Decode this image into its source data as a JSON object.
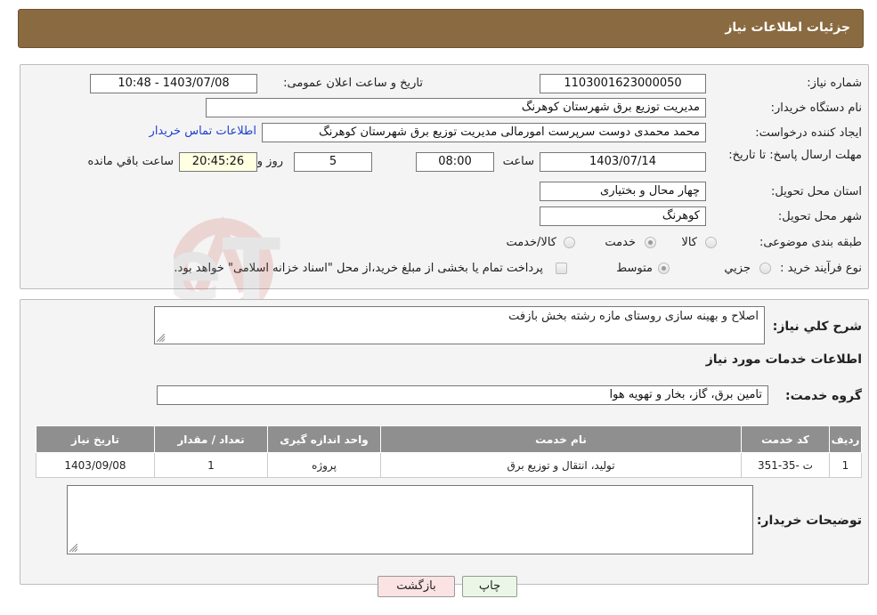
{
  "header": {
    "title": "جزئیات اطلاعات نیاز"
  },
  "form": {
    "need_number": {
      "label": "شماره نیاز:",
      "value": "1103001623000050"
    },
    "announce_datetime": {
      "label": "تاریخ و ساعت اعلان عمومی:",
      "value": "1403/07/08 - 10:48"
    },
    "buyer_org": {
      "label": "نام دستگاه خریدار:",
      "value": "مدیریت توزیع برق شهرستان کوهرنگ"
    },
    "requester": {
      "label": "ایجاد کننده درخواست:",
      "value": "محمد محمدی دوست سرپرست امورمالی مدیریت توزیع برق شهرستان کوهرنگ",
      "contact_link": "اطلاعات تماس خریدار"
    },
    "deadline": {
      "label": "مهلت ارسال پاسخ: تا تاریخ:",
      "date": "1403/07/14",
      "time_label": "ساعت",
      "time": "08:00",
      "days": "5",
      "days_label": "روز و",
      "remaining": "20:45:26",
      "remaining_label": "ساعت باقي مانده"
    },
    "province": {
      "label": "استان محل تحویل:",
      "value": "چهار محال و بختیاری"
    },
    "city": {
      "label": "شهر محل تحویل:",
      "value": "کوهرنگ"
    },
    "category": {
      "label": "طبقه بندی موضوعی:",
      "options": [
        "کالا",
        "خدمت",
        "کالا/خدمت"
      ],
      "selected": "خدمت"
    },
    "purchase_type": {
      "label": "نوع فرآیند خرید :",
      "options": [
        "جزیي",
        "متوسط"
      ],
      "selected": "متوسط",
      "note": "پرداخت تمام یا بخشی از مبلغ خرید،از محل \"اسناد خزانه اسلامی\" خواهد بود."
    }
  },
  "summary": {
    "label": "شرح کلي نياز:",
    "value": "اصلاح و بهینه سازی روستای مازه رشته بخش بازفت"
  },
  "services": {
    "section_title": "اطلاعات خدمات مورد نياز",
    "group_label": "گروه خدمت:",
    "group_value": "تامین برق، گاز، بخار و تهویه هوا",
    "table": {
      "headers": [
        "ردیف",
        "کد خدمت",
        "نام خدمت",
        "واحد اندازه گیری",
        "تعداد / مقدار",
        "تاریخ نیاز"
      ],
      "rows": [
        [
          "1",
          "ت -35-351",
          "تولید، انتقال و توزیع برق",
          "پروژه",
          "1",
          "1403/09/08"
        ]
      ]
    }
  },
  "buyer_notes": {
    "label": "توضیحات خریدار:",
    "value": ""
  },
  "buttons": {
    "print": "چاپ",
    "back": "بازگشت"
  },
  "colors": {
    "header_bg": "#8a6a40",
    "table_header_bg": "#8f8f8f",
    "link": "#1f3fd0"
  }
}
